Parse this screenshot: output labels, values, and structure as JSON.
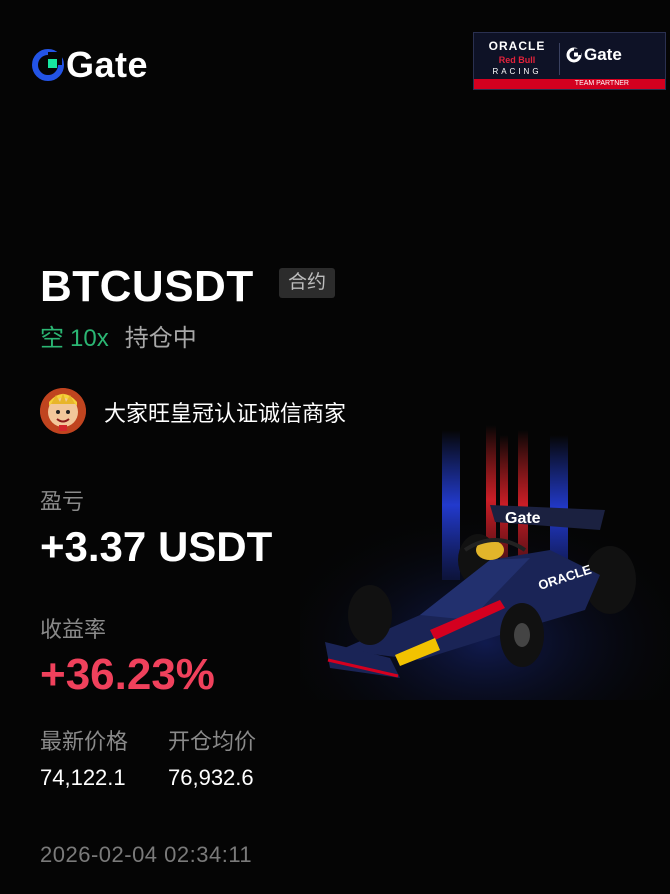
{
  "brand": {
    "name": "Gate"
  },
  "partner_badge": {
    "line1": "ORACLE",
    "line2": "Red Bull",
    "line3": "RACING",
    "gate": "Gate",
    "caption": "TEAM PARTNER"
  },
  "trade": {
    "pair": "BTCUSDT",
    "type_tag": "合约",
    "side": "空",
    "leverage": "10x",
    "status": "持仓中"
  },
  "user": {
    "name": "大家旺皇冠认证诚信商家"
  },
  "stats": {
    "pnl_label": "盈亏",
    "pnl_value": "+3.37 USDT",
    "roi_label": "收益率",
    "roi_value": "+36.23%",
    "last_price_label": "最新价格",
    "last_price_value": "74,122.1",
    "entry_price_label": "开仓均价",
    "entry_price_value": "76,932.6"
  },
  "timestamp": "2026-02-04 02:34:11",
  "colors": {
    "background": "#050505",
    "short_green": "#2bb673",
    "profit_red": "#f0415c",
    "brand_blue": "#2354e6"
  },
  "icons": [
    "gate-logo-icon",
    "avatar-icon",
    "f1-car-illustration"
  ]
}
